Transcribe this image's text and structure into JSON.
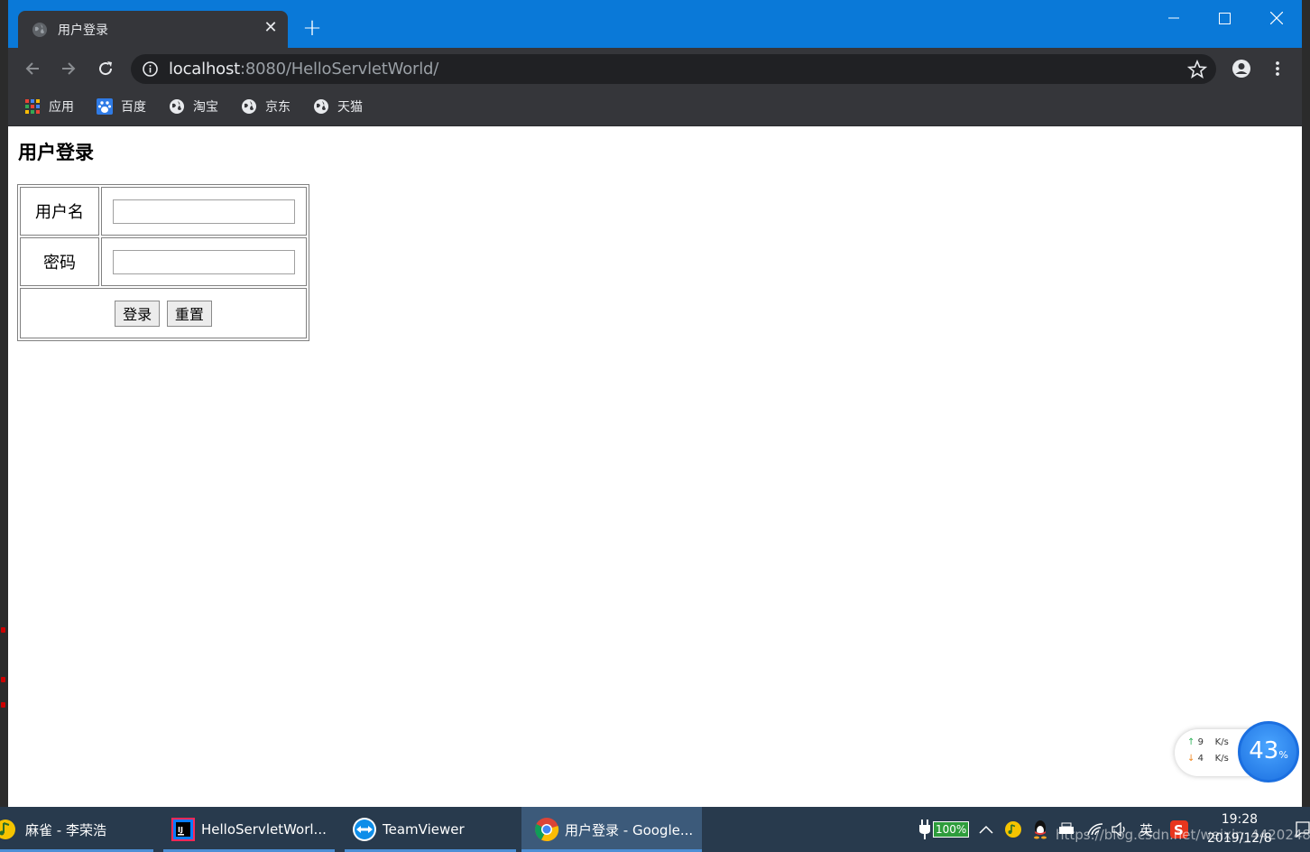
{
  "browser": {
    "tab_title": "用户登录",
    "tab_close": "✕",
    "new_tab": "+",
    "url_host": "localhost",
    "url_rest": ":8080/HelloServletWorld/",
    "bookmarks": [
      {
        "label": "应用",
        "icon": "apps-grid-icon"
      },
      {
        "label": "百度",
        "icon": "baidu-paw-icon"
      },
      {
        "label": "淘宝",
        "icon": "globe-icon"
      },
      {
        "label": "京东",
        "icon": "globe-icon"
      },
      {
        "label": "天猫",
        "icon": "globe-icon"
      }
    ]
  },
  "page": {
    "title": "用户登录",
    "username_label": "用户名",
    "username_value": "",
    "password_label": "密码",
    "password_value": "",
    "login_button": "登录",
    "reset_button": "重置"
  },
  "netmonitor": {
    "up_value": "9",
    "up_unit": "K/s",
    "down_value": "4",
    "down_unit": "K/s",
    "usage_percent": "43",
    "usage_unit": "%"
  },
  "taskbar": {
    "items": [
      {
        "label": "麻雀 - 李荣浩",
        "icon": "music-icon"
      },
      {
        "label": "HelloServletWorl...",
        "icon": "intellij-icon"
      },
      {
        "label": "TeamViewer",
        "icon": "teamviewer-icon"
      },
      {
        "label": "用户登录 - Google...",
        "icon": "chrome-icon"
      }
    ],
    "battery": "100%",
    "ime": "英",
    "time": "19:28",
    "date": "2019/12/8",
    "watermark": "https://blog.csdn.net/weixin_44202489"
  },
  "colors": {
    "titlebar": "#0a79d8",
    "toolbar": "#35363a",
    "taskbar": "#283a4d"
  }
}
